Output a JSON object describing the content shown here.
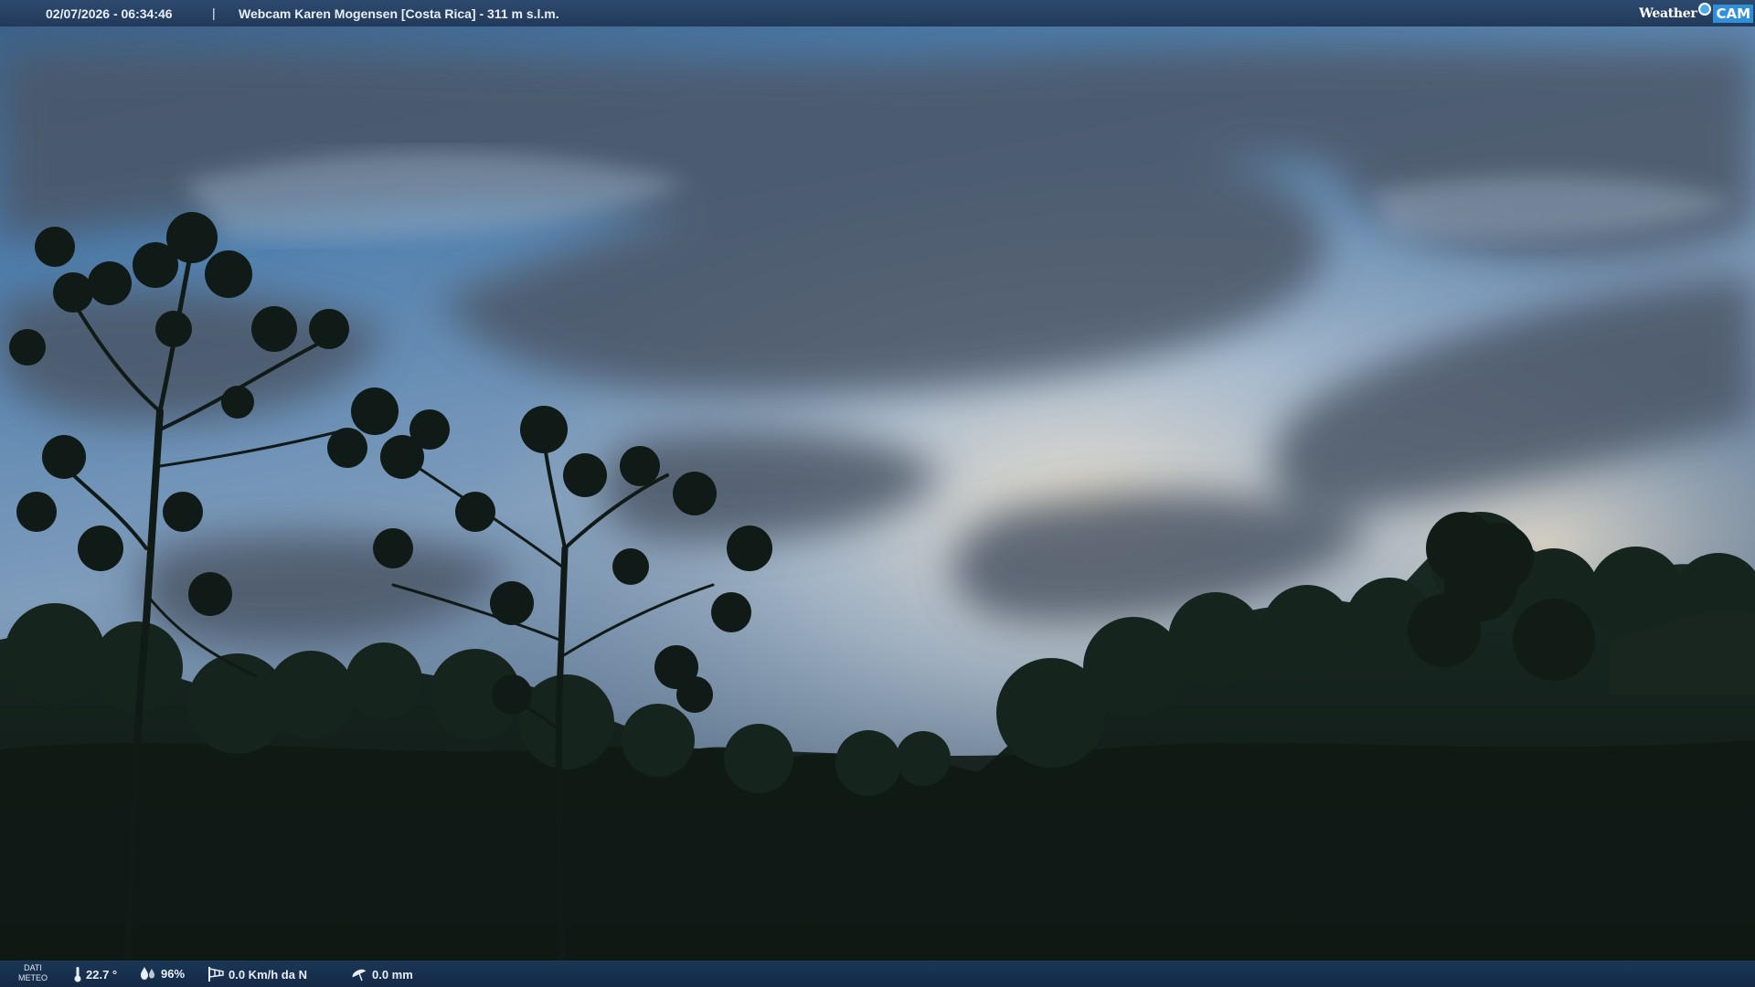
{
  "top_bar": {
    "datetime": "02/07/2026 - 06:34:46",
    "separator": "|",
    "caption": "Webcam Karen Mogensen [Costa Rica]  - 311 m s.l.m."
  },
  "logo": {
    "word": "Weather",
    "cam": "CAM"
  },
  "bottom_bar": {
    "label_line1": "DATI",
    "label_line2": "METEO",
    "temperature": "22.7 °",
    "humidity": "96%",
    "wind": "0.0 Km/h da N",
    "rain": "0.0 mm"
  },
  "colors": {
    "bar_top": "#2d4a6e",
    "bar_bottom": "#1b3656",
    "sky_upper": "#4f7fae",
    "sky_light": "#e8dfcf",
    "forest": "#111d17"
  }
}
